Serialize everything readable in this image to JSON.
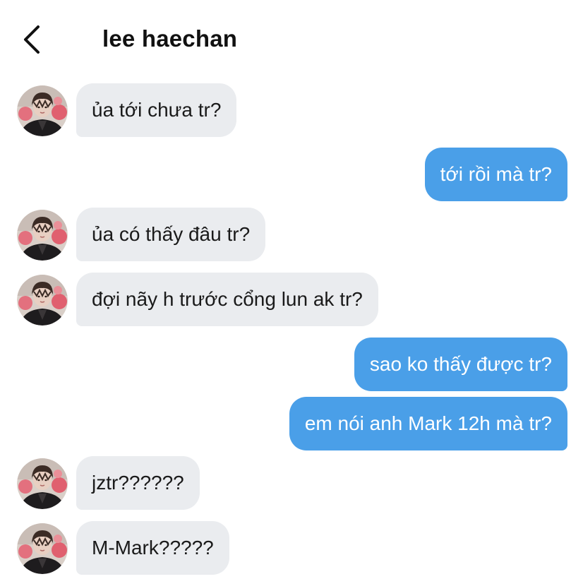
{
  "header": {
    "back_icon": "chevron-left-icon",
    "title": "lee haechan"
  },
  "contact": {
    "avatar_icon": "profile-photo"
  },
  "colors": {
    "incoming_bubble": "#eaecef",
    "outgoing_bubble": "#4a9fe8",
    "outgoing_text": "#ffffff"
  },
  "messages": [
    {
      "direction": "incoming",
      "text": "ủa tới chưa tr?"
    },
    {
      "direction": "outgoing",
      "text": "tới rồi mà tr?"
    },
    {
      "direction": "incoming",
      "text": "ủa có thấy đâu tr?"
    },
    {
      "direction": "incoming",
      "text": "đợi nãy h trước cổng lun ak tr?"
    },
    {
      "direction": "outgoing",
      "text": "sao ko thấy được tr?"
    },
    {
      "direction": "outgoing",
      "text": "em nói anh Mark 12h mà tr?"
    },
    {
      "direction": "incoming",
      "text": "jztr??????"
    },
    {
      "direction": "incoming",
      "text": "M-Mark?????"
    }
  ]
}
